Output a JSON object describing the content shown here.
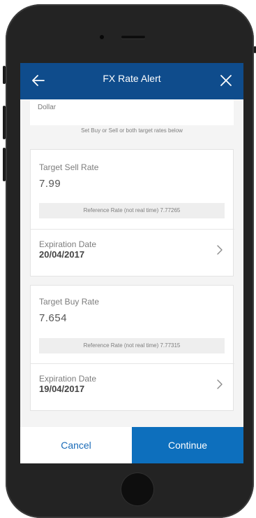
{
  "header": {
    "title": "FX Rate Alert"
  },
  "currency": {
    "name": "Dollar"
  },
  "hint": "Set Buy or Sell or both target rates below",
  "sell": {
    "label": "Target Sell Rate",
    "value": "7.99",
    "reference": "Reference Rate (not real time) 7.77265",
    "expiration_label": "Expiration Date",
    "expiration_date": "20/04/2017"
  },
  "buy": {
    "label": "Target Buy Rate",
    "value": "7.654",
    "reference": "Reference Rate (not real time) 7.77315",
    "expiration_label": "Expiration Date",
    "expiration_date": "19/04/2017"
  },
  "footer": {
    "cancel_label": "Cancel",
    "continue_label": "Continue"
  },
  "colors": {
    "header_bg": "#0f4c8c",
    "continue_bg": "#0d6fbd",
    "cancel_text": "#1a6bb8"
  },
  "icons": {
    "back": "arrow-left-icon",
    "close": "close-icon",
    "chevron": "chevron-right-icon"
  }
}
